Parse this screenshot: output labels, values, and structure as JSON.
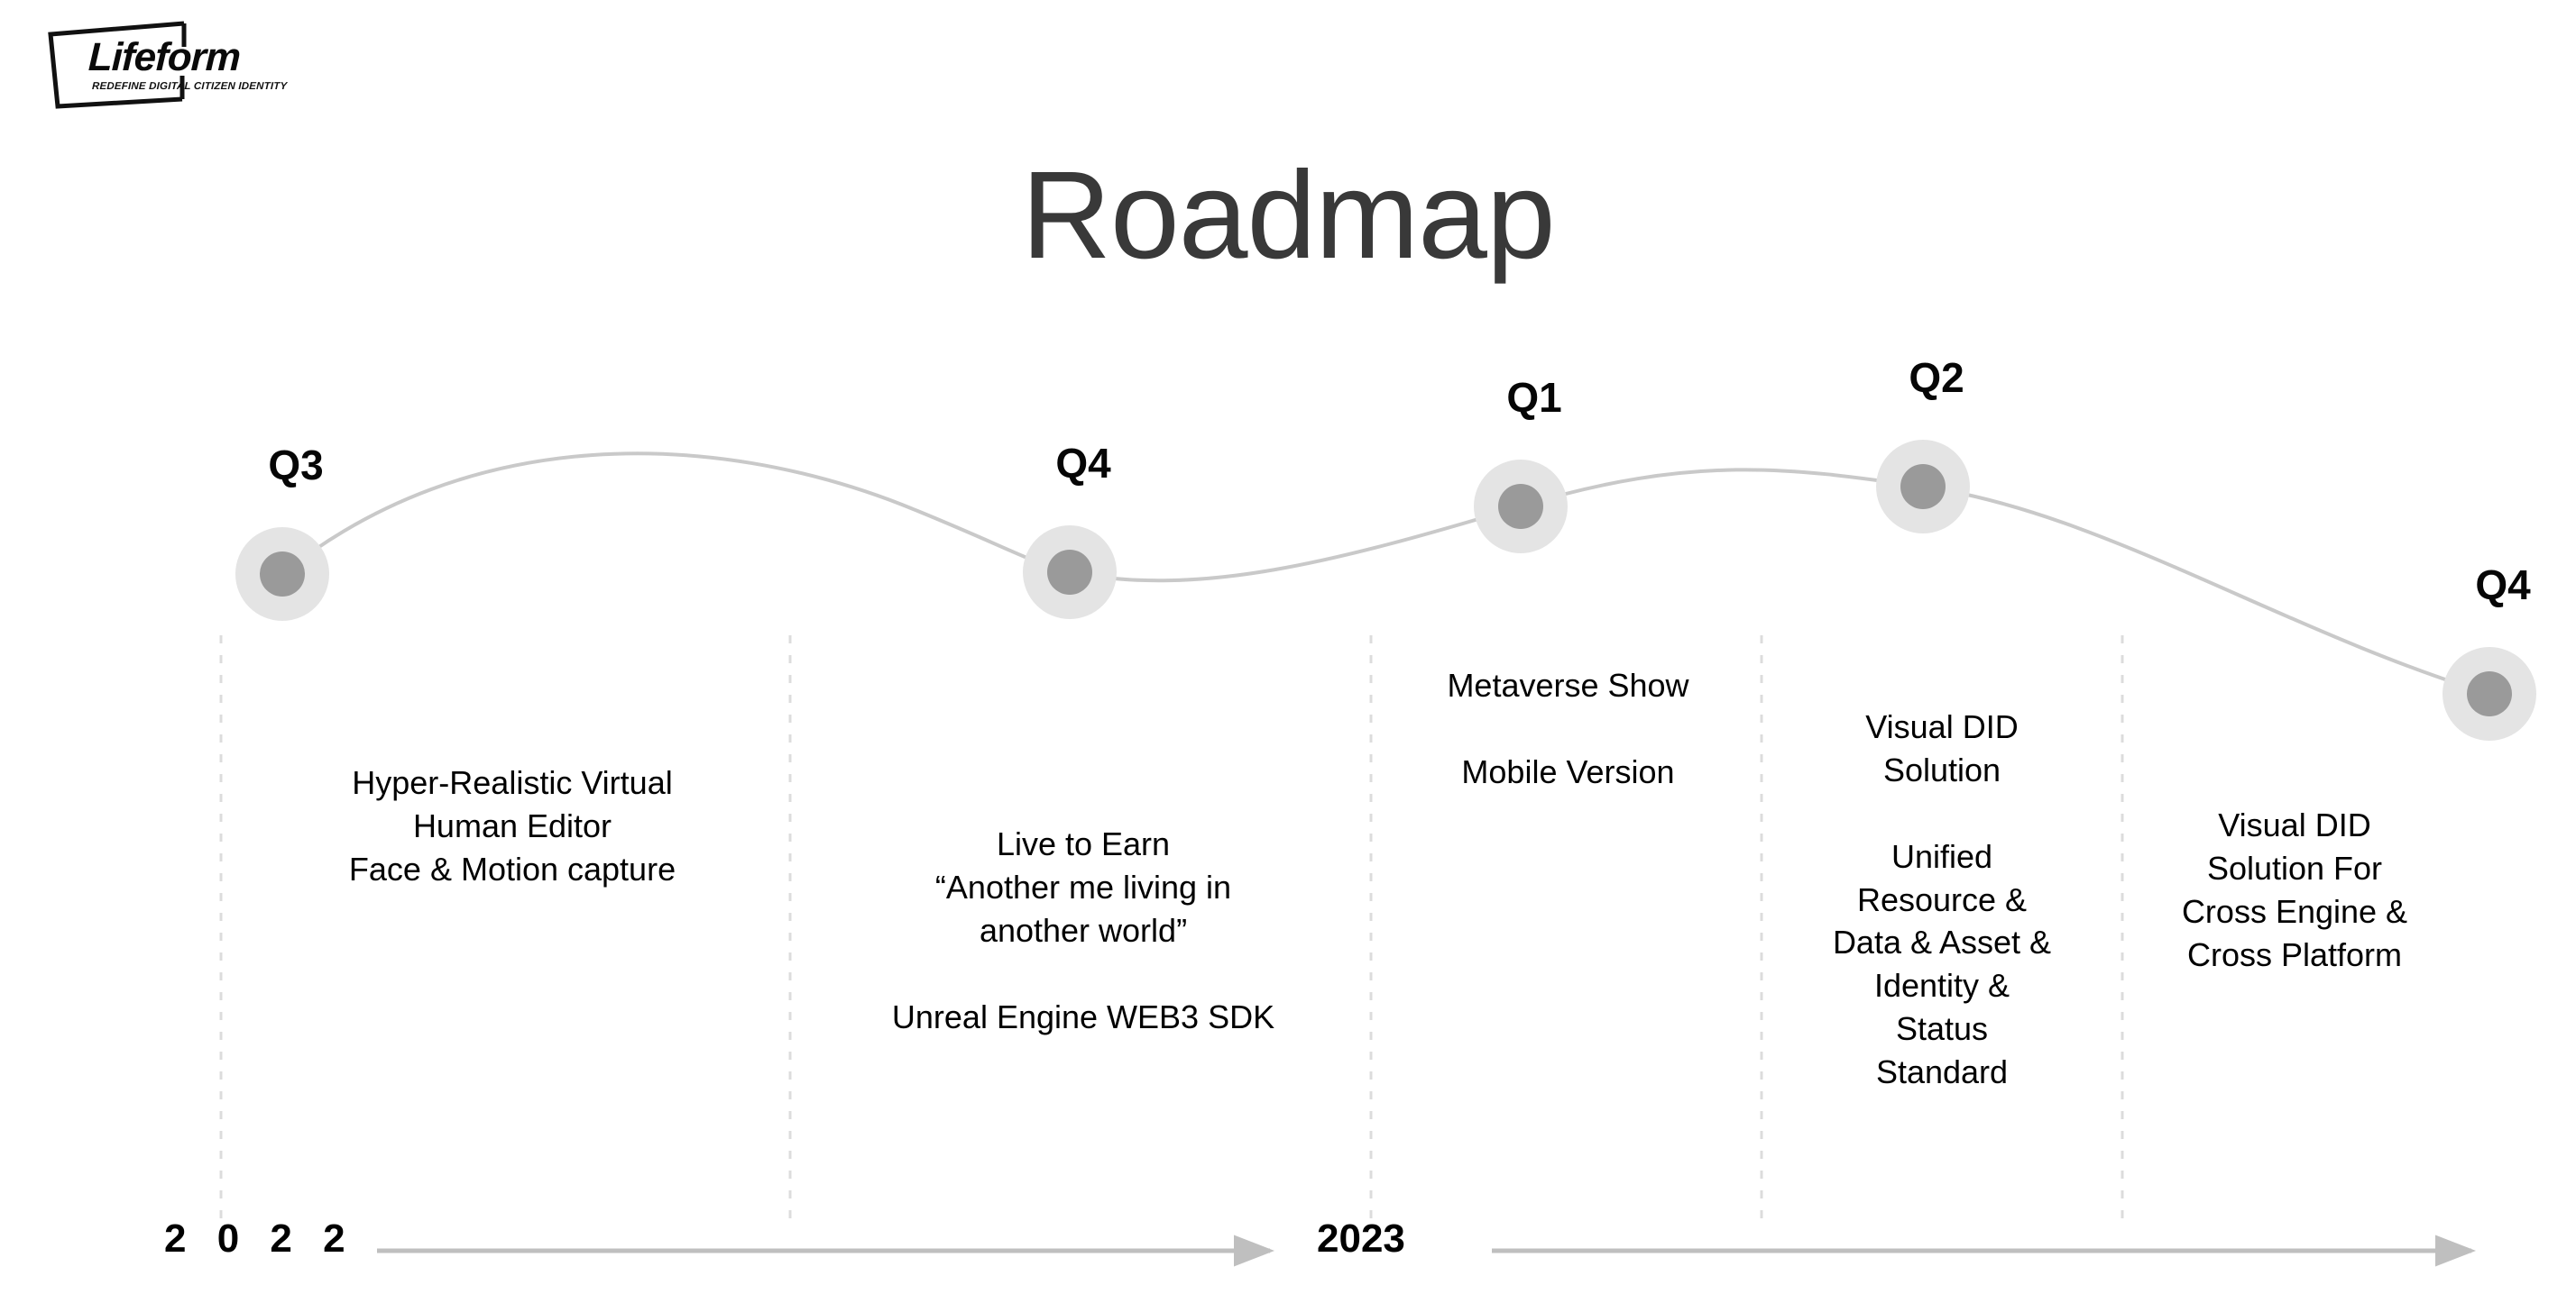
{
  "brand": {
    "wordmark": "Lifeform",
    "tagline": "REDEFINE DIGITAL CITIZEN IDENTITY",
    "frame_color": "#111111"
  },
  "title": "Roadmap",
  "colors": {
    "title": "#393939",
    "marker_halo": "#e4e4e4",
    "marker_dot": "#9a9a9a",
    "curve": "#c9c9c9",
    "divider": "#dcdcdc",
    "axis": "#bfbfbf",
    "text": "#000000"
  },
  "timeline": {
    "years": [
      {
        "label": "2 0 2 2"
      },
      {
        "label": "2023"
      }
    ],
    "milestones": [
      {
        "quarter": "Q3",
        "year": "2022",
        "items": "Hyper-Realistic Virtual\nHuman Editor\nFace & Motion capture"
      },
      {
        "quarter": "Q4",
        "year": "2022",
        "items": "Live to Earn\n“Another me living in\nanother world”\n\nUnreal Engine WEB3 SDK"
      },
      {
        "quarter": "Q1",
        "year": "2023",
        "items": "Metaverse Show\n\nMobile Version"
      },
      {
        "quarter": "Q2",
        "year": "2023",
        "items": "Visual DID\nSolution\n\nUnified\nResource &\nData & Asset &\nIdentity &\nStatus\nStandard"
      },
      {
        "quarter": "Q4",
        "year": "2023",
        "items": "Visual DID\nSolution For\nCross Engine &\nCross Platform"
      }
    ]
  }
}
